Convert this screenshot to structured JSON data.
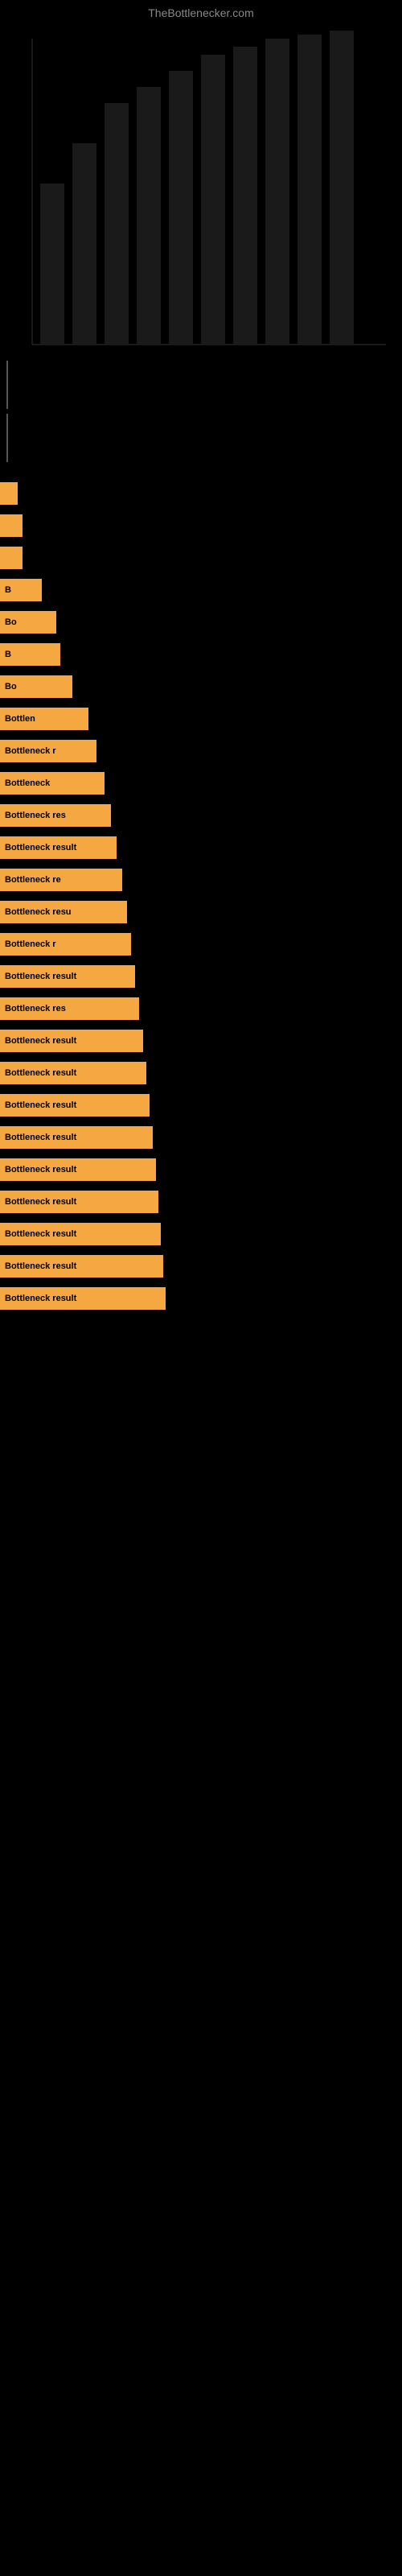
{
  "site": {
    "title": "TheBottlenecker.com"
  },
  "results": [
    {
      "id": 1,
      "label": "",
      "bar_class": "bar-1"
    },
    {
      "id": 2,
      "label": "",
      "bar_class": "bar-2"
    },
    {
      "id": 3,
      "label": "",
      "bar_class": "bar-3"
    },
    {
      "id": 4,
      "label": "B",
      "bar_class": "bar-4"
    },
    {
      "id": 5,
      "label": "Bo",
      "bar_class": "bar-5"
    },
    {
      "id": 6,
      "label": "B",
      "bar_class": "bar-6"
    },
    {
      "id": 7,
      "label": "Bo",
      "bar_class": "bar-7"
    },
    {
      "id": 8,
      "label": "Bottlen",
      "bar_class": "bar-8"
    },
    {
      "id": 9,
      "label": "Bottleneck r",
      "bar_class": "bar-9"
    },
    {
      "id": 10,
      "label": "Bottleneck",
      "bar_class": "bar-10"
    },
    {
      "id": 11,
      "label": "Bottleneck res",
      "bar_class": "bar-11"
    },
    {
      "id": 12,
      "label": "Bottleneck result",
      "bar_class": "bar-12"
    },
    {
      "id": 13,
      "label": "Bottleneck re",
      "bar_class": "bar-13"
    },
    {
      "id": 14,
      "label": "Bottleneck resu",
      "bar_class": "bar-14"
    },
    {
      "id": 15,
      "label": "Bottleneck r",
      "bar_class": "bar-15"
    },
    {
      "id": 16,
      "label": "Bottleneck result",
      "bar_class": "bar-16"
    },
    {
      "id": 17,
      "label": "Bottleneck res",
      "bar_class": "bar-17"
    },
    {
      "id": 18,
      "label": "Bottleneck result",
      "bar_class": "bar-18"
    },
    {
      "id": 19,
      "label": "Bottleneck result",
      "bar_class": "bar-19"
    },
    {
      "id": 20,
      "label": "Bottleneck result",
      "bar_class": "bar-20"
    },
    {
      "id": 21,
      "label": "Bottleneck result",
      "bar_class": "bar-21"
    },
    {
      "id": 22,
      "label": "Bottleneck result",
      "bar_class": "bar-22"
    },
    {
      "id": 23,
      "label": "Bottleneck result",
      "bar_class": "bar-23"
    },
    {
      "id": 24,
      "label": "Bottleneck result",
      "bar_class": "bar-24"
    },
    {
      "id": 25,
      "label": "Bottleneck result",
      "bar_class": "bar-25"
    },
    {
      "id": 26,
      "label": "Bottleneck result",
      "bar_class": "bar-26"
    }
  ]
}
